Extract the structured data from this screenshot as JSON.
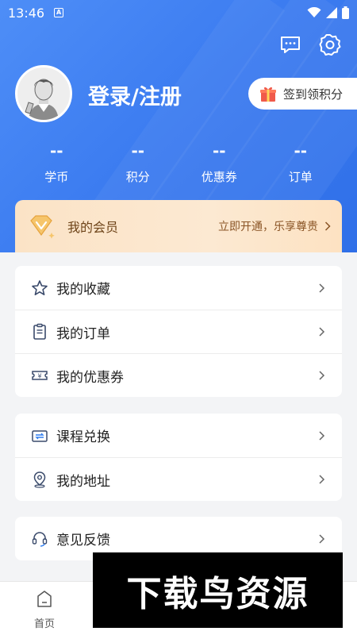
{
  "status_bar": {
    "time": "13:46",
    "notif_letter": "A"
  },
  "profile": {
    "login_label": "登录/注册",
    "signin_label": "签到领积分"
  },
  "stats": [
    {
      "value": "--",
      "label": "学币"
    },
    {
      "value": "--",
      "label": "积分"
    },
    {
      "value": "--",
      "label": "优惠券"
    },
    {
      "value": "--",
      "label": "订单"
    }
  ],
  "vip": {
    "title": "我的会员",
    "action": "立即开通，乐享尊贵"
  },
  "menu_group1": [
    {
      "label": "我的收藏",
      "icon": "star-icon"
    },
    {
      "label": "我的订单",
      "icon": "clipboard-icon"
    },
    {
      "label": "我的优惠券",
      "icon": "coupon-icon"
    }
  ],
  "menu_group2": [
    {
      "label": "课程兑换",
      "icon": "exchange-icon"
    },
    {
      "label": "我的地址",
      "icon": "location-icon"
    }
  ],
  "menu_group3": [
    {
      "label": "意见反馈",
      "icon": "headset-icon"
    }
  ],
  "tabbar": {
    "home_label": "首页"
  },
  "watermark": "下载鸟资源",
  "colors": {
    "primary": "#3b7bf0",
    "vip_text": "#6e4419"
  }
}
